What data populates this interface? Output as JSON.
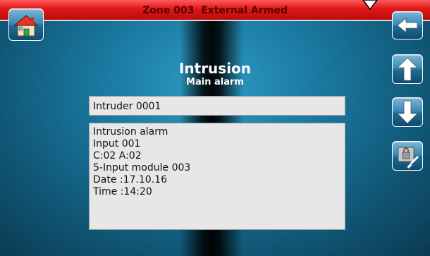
{
  "header": {
    "status_title": "Zone 003  External Armed",
    "bar_color": "#e01818"
  },
  "navigation": {
    "home_icon": "home-icon",
    "back_icon": "arrow-left-icon",
    "up_icon": "arrow-up-icon",
    "down_icon": "arrow-down-icon",
    "clear_icon": "lock-brush-icon"
  },
  "main": {
    "title": "Intrusion",
    "subtitle": "Main alarm",
    "name_field": "Intruder 0001",
    "details": [
      "Intrusion alarm",
      "Input 001",
      "C:02 A:02",
      "5-Input module 003",
      "Date :17.10.16",
      "Time :14:20"
    ]
  }
}
